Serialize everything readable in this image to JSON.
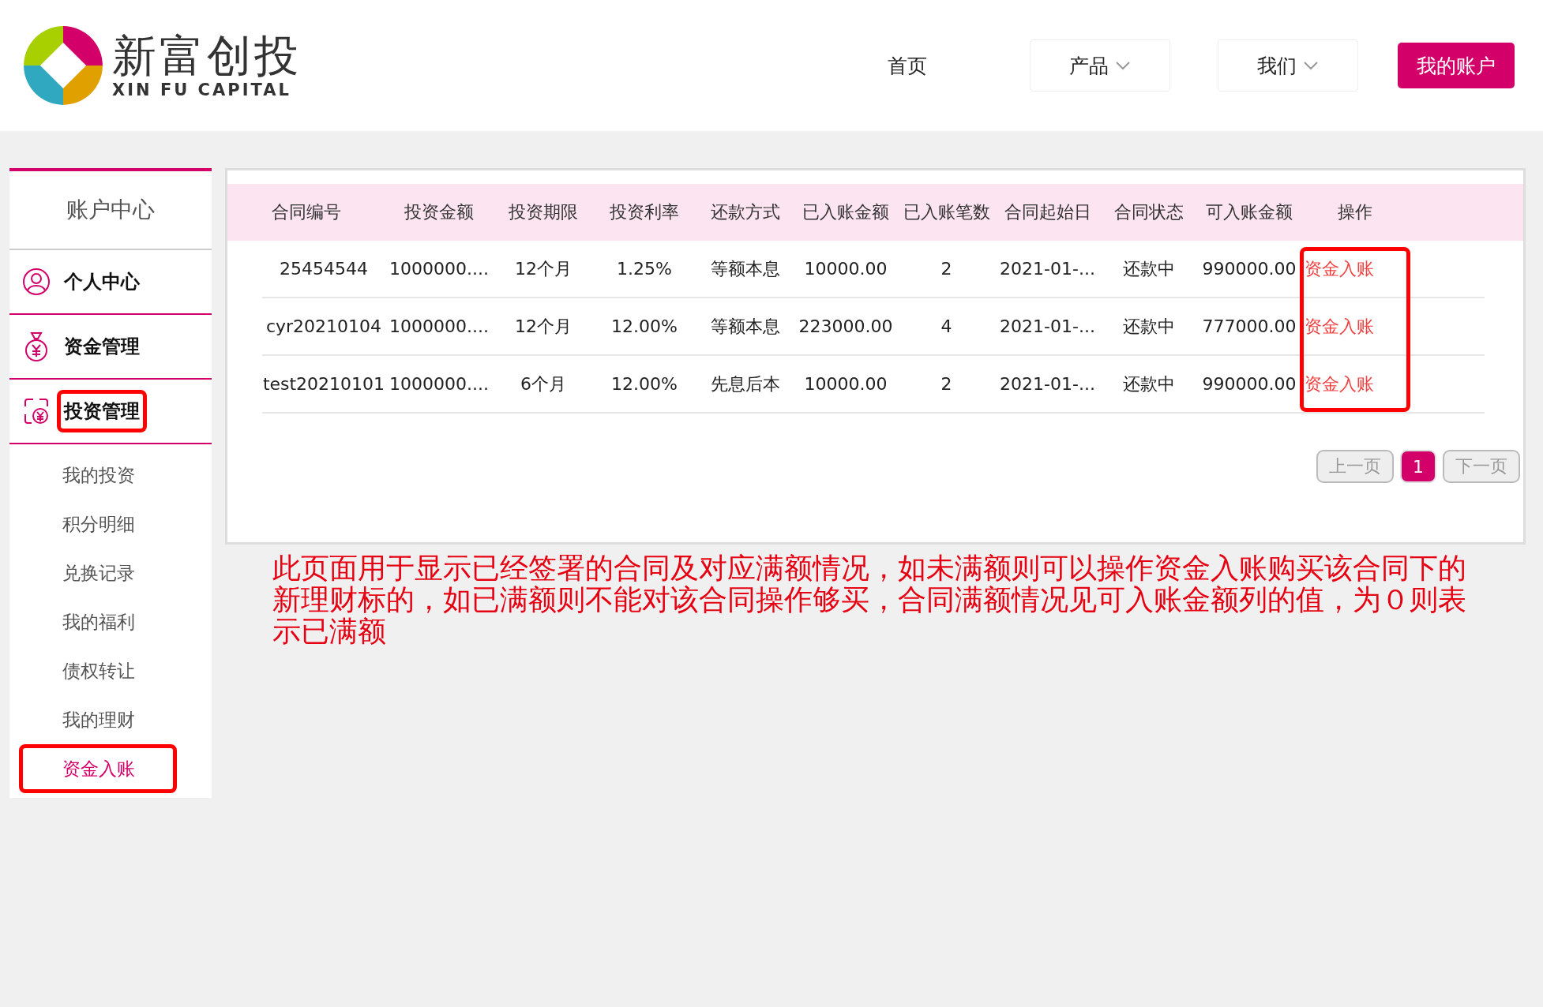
{
  "logo": {
    "name": "新富创投",
    "tagline": "XIN FU CAPITAL"
  },
  "nav": [
    {
      "label": "首页",
      "kind": "link"
    },
    {
      "label": "产品",
      "kind": "dropdown"
    },
    {
      "label": "我们",
      "kind": "dropdown"
    },
    {
      "label": "我的账户",
      "kind": "primary"
    }
  ],
  "sidebar": {
    "title": "账户中心",
    "items": [
      {
        "label": "个人中心",
        "highlighted": false
      },
      {
        "label": "资金管理",
        "highlighted": false
      },
      {
        "label": "投资管理",
        "highlighted": true,
        "children": [
          {
            "label": "我的投资",
            "selected": false,
            "highlighted": false
          },
          {
            "label": "积分明细",
            "selected": false,
            "highlighted": false
          },
          {
            "label": "兑换记录",
            "selected": false,
            "highlighted": false
          },
          {
            "label": "我的福利",
            "selected": false,
            "highlighted": false
          },
          {
            "label": "债权转让",
            "selected": false,
            "highlighted": false
          },
          {
            "label": "我的理财",
            "selected": false,
            "highlighted": false
          },
          {
            "label": "资金入账",
            "selected": true,
            "highlighted": true
          }
        ]
      }
    ]
  },
  "table": {
    "columns": [
      "合同编号",
      "投资金额",
      "投资期限",
      "投资利率",
      "还款方式",
      "已入账金额",
      "已入账笔数",
      "合同起始日",
      "合同状态",
      "可入账金额",
      "操作"
    ],
    "rows": [
      {
        "cells": [
          "25454544",
          "1000000....",
          "12个月",
          "1.25%",
          "等额本息",
          "10000.00",
          "2",
          "2021-01-...",
          "还款中",
          "990000.00"
        ],
        "action": "资金入账"
      },
      {
        "cells": [
          "cyr20210104",
          "1000000....",
          "12个月",
          "12.00%",
          "等额本息",
          "223000.00",
          "4",
          "2021-01-...",
          "还款中",
          "777000.00"
        ],
        "action": "资金入账"
      },
      {
        "cells": [
          "test20210101",
          "1000000....",
          "6个月",
          "12.00%",
          "先息后本",
          "10000.00",
          "2",
          "2021-01-...",
          "还款中",
          "990000.00"
        ],
        "action": "资金入账"
      }
    ],
    "action_column_highlighted": true
  },
  "pagination": {
    "prev": {
      "label": "上一页",
      "disabled": true
    },
    "pages": [
      {
        "label": "1",
        "selected": true
      }
    ],
    "next": {
      "label": "下一页",
      "disabled": true
    }
  },
  "note": "此页面用于显示已经签署的合同及对应满额情况，如未满额则可以操作资金入账购买该合同下的新理财标的，如已满额则不能对该合同操作够买，合同满额情况见可入账金额列的值，为０则表示已满额"
}
